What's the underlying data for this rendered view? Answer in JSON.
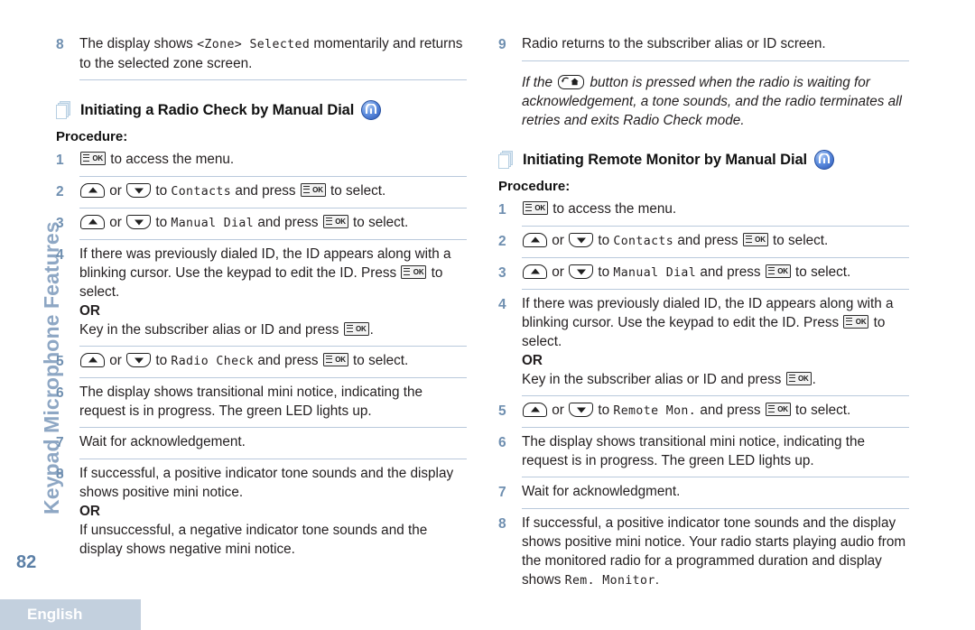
{
  "sidebar": {
    "tab_label": "Keypad Microphone Features",
    "page_number": "82"
  },
  "footer": {
    "language": "English"
  },
  "icons": {
    "ok_key": "OK",
    "pages": "pages-icon",
    "feature": "feature-icon",
    "up_key": "up-arrow-key",
    "down_key": "down-arrow-key",
    "back_key": "back-home-key"
  },
  "left_column": {
    "continued_step": {
      "number": "8",
      "text_a": "The display shows ",
      "display_text": "<Zone> Selected",
      "text_b": " momentarily and returns to the selected zone screen."
    },
    "heading": "Initiating a Radio Check by Manual Dial",
    "procedure_label": "Procedure:",
    "steps": [
      {
        "number": "1",
        "parts": [
          {
            "type": "key_ok"
          },
          {
            "type": "text",
            "value": " to access the menu."
          }
        ]
      },
      {
        "number": "2",
        "parts": [
          {
            "type": "key_up"
          },
          {
            "type": "text",
            "value": " or "
          },
          {
            "type": "key_down"
          },
          {
            "type": "text",
            "value": " to "
          },
          {
            "type": "disp",
            "value": "Contacts"
          },
          {
            "type": "text",
            "value": " and press "
          },
          {
            "type": "key_ok"
          },
          {
            "type": "text",
            "value": " to select."
          }
        ]
      },
      {
        "number": "3",
        "parts": [
          {
            "type": "key_up"
          },
          {
            "type": "text",
            "value": " or "
          },
          {
            "type": "key_down"
          },
          {
            "type": "text",
            "value": " to "
          },
          {
            "type": "disp",
            "value": "Manual Dial"
          },
          {
            "type": "text",
            "value": " and press "
          },
          {
            "type": "key_ok"
          },
          {
            "type": "text",
            "value": " to select."
          }
        ]
      },
      {
        "number": "4",
        "parts": [
          {
            "type": "text",
            "value": "If there was previously dialed ID, the ID appears along with a blinking cursor. Use the keypad to edit the ID. Press "
          },
          {
            "type": "key_ok"
          },
          {
            "type": "text",
            "value": " to select."
          },
          {
            "type": "or"
          },
          {
            "type": "text",
            "value": "Key in the subscriber alias or ID and press "
          },
          {
            "type": "key_ok"
          },
          {
            "type": "text",
            "value": "."
          }
        ]
      },
      {
        "number": "5",
        "parts": [
          {
            "type": "key_up"
          },
          {
            "type": "text",
            "value": " or "
          },
          {
            "type": "key_down"
          },
          {
            "type": "text",
            "value": " to "
          },
          {
            "type": "disp",
            "value": "Radio Check"
          },
          {
            "type": "text",
            "value": " and press "
          },
          {
            "type": "key_ok"
          },
          {
            "type": "text",
            "value": " to select."
          }
        ]
      },
      {
        "number": "6",
        "parts": [
          {
            "type": "text",
            "value": "The display shows transitional mini notice, indicating the request is in progress. The green LED lights up."
          }
        ]
      },
      {
        "number": "7",
        "parts": [
          {
            "type": "text",
            "value": "Wait for acknowledgement."
          }
        ]
      },
      {
        "number": "8",
        "parts": [
          {
            "type": "text",
            "value": "If successful, a positive indicator tone sounds and the display shows positive mini notice."
          },
          {
            "type": "or"
          },
          {
            "type": "text",
            "value": "If unsuccessful, a negative indicator tone sounds and the display shows negative mini notice."
          }
        ]
      }
    ],
    "or_label": "OR"
  },
  "right_column": {
    "continued_step": {
      "number": "9",
      "text": "Radio returns to the subscriber alias or ID screen."
    },
    "note": {
      "text_a": "If the ",
      "text_b": " button is pressed when the radio is waiting for acknowledgement, a tone sounds, and the radio terminates all retries and exits Radio Check mode."
    },
    "heading": "Initiating Remote Monitor by Manual Dial",
    "procedure_label": "Procedure:",
    "or_label": "OR",
    "steps": [
      {
        "number": "1",
        "parts": [
          {
            "type": "key_ok"
          },
          {
            "type": "text",
            "value": " to access the menu."
          }
        ]
      },
      {
        "number": "2",
        "parts": [
          {
            "type": "key_up"
          },
          {
            "type": "text",
            "value": " or "
          },
          {
            "type": "key_down"
          },
          {
            "type": "text",
            "value": " to "
          },
          {
            "type": "disp",
            "value": "Contacts"
          },
          {
            "type": "text",
            "value": " and press "
          },
          {
            "type": "key_ok"
          },
          {
            "type": "text",
            "value": " to select."
          }
        ]
      },
      {
        "number": "3",
        "parts": [
          {
            "type": "key_up"
          },
          {
            "type": "text",
            "value": " or "
          },
          {
            "type": "key_down"
          },
          {
            "type": "text",
            "value": " to "
          },
          {
            "type": "disp",
            "value": "Manual Dial"
          },
          {
            "type": "text",
            "value": " and press "
          },
          {
            "type": "key_ok"
          },
          {
            "type": "text",
            "value": " to select."
          }
        ]
      },
      {
        "number": "4",
        "parts": [
          {
            "type": "text",
            "value": "If there was previously dialed ID, the ID appears along with a blinking cursor. Use the keypad to edit the ID. Press "
          },
          {
            "type": "key_ok"
          },
          {
            "type": "text",
            "value": " to select."
          },
          {
            "type": "or"
          },
          {
            "type": "text",
            "value": "Key in the subscriber alias or ID and press "
          },
          {
            "type": "key_ok"
          },
          {
            "type": "text",
            "value": "."
          }
        ]
      },
      {
        "number": "5",
        "parts": [
          {
            "type": "key_up"
          },
          {
            "type": "text",
            "value": " or "
          },
          {
            "type": "key_down"
          },
          {
            "type": "text",
            "value": " to "
          },
          {
            "type": "disp",
            "value": "Remote Mon."
          },
          {
            "type": "text",
            "value": " and press "
          },
          {
            "type": "key_ok"
          },
          {
            "type": "text",
            "value": " to select."
          }
        ]
      },
      {
        "number": "6",
        "parts": [
          {
            "type": "text",
            "value": "The display shows transitional mini notice, indicating the request is in progress. The green LED lights up."
          }
        ]
      },
      {
        "number": "7",
        "parts": [
          {
            "type": "text",
            "value": "Wait for acknowledgment."
          }
        ]
      },
      {
        "number": "8",
        "parts": [
          {
            "type": "text",
            "value": "If successful, a positive indicator tone sounds and the display shows positive mini notice. Your radio starts playing audio from the monitored radio for a programmed duration and display shows "
          },
          {
            "type": "disp",
            "value": "Rem. Monitor"
          },
          {
            "type": "text",
            "value": "."
          }
        ]
      }
    ]
  },
  "colors": {
    "accent_blue": "#6f8fb0",
    "rule": "#b9c9dc",
    "sidebar_text": "#8ea7c4",
    "footer_bar": "#c3d0de"
  }
}
